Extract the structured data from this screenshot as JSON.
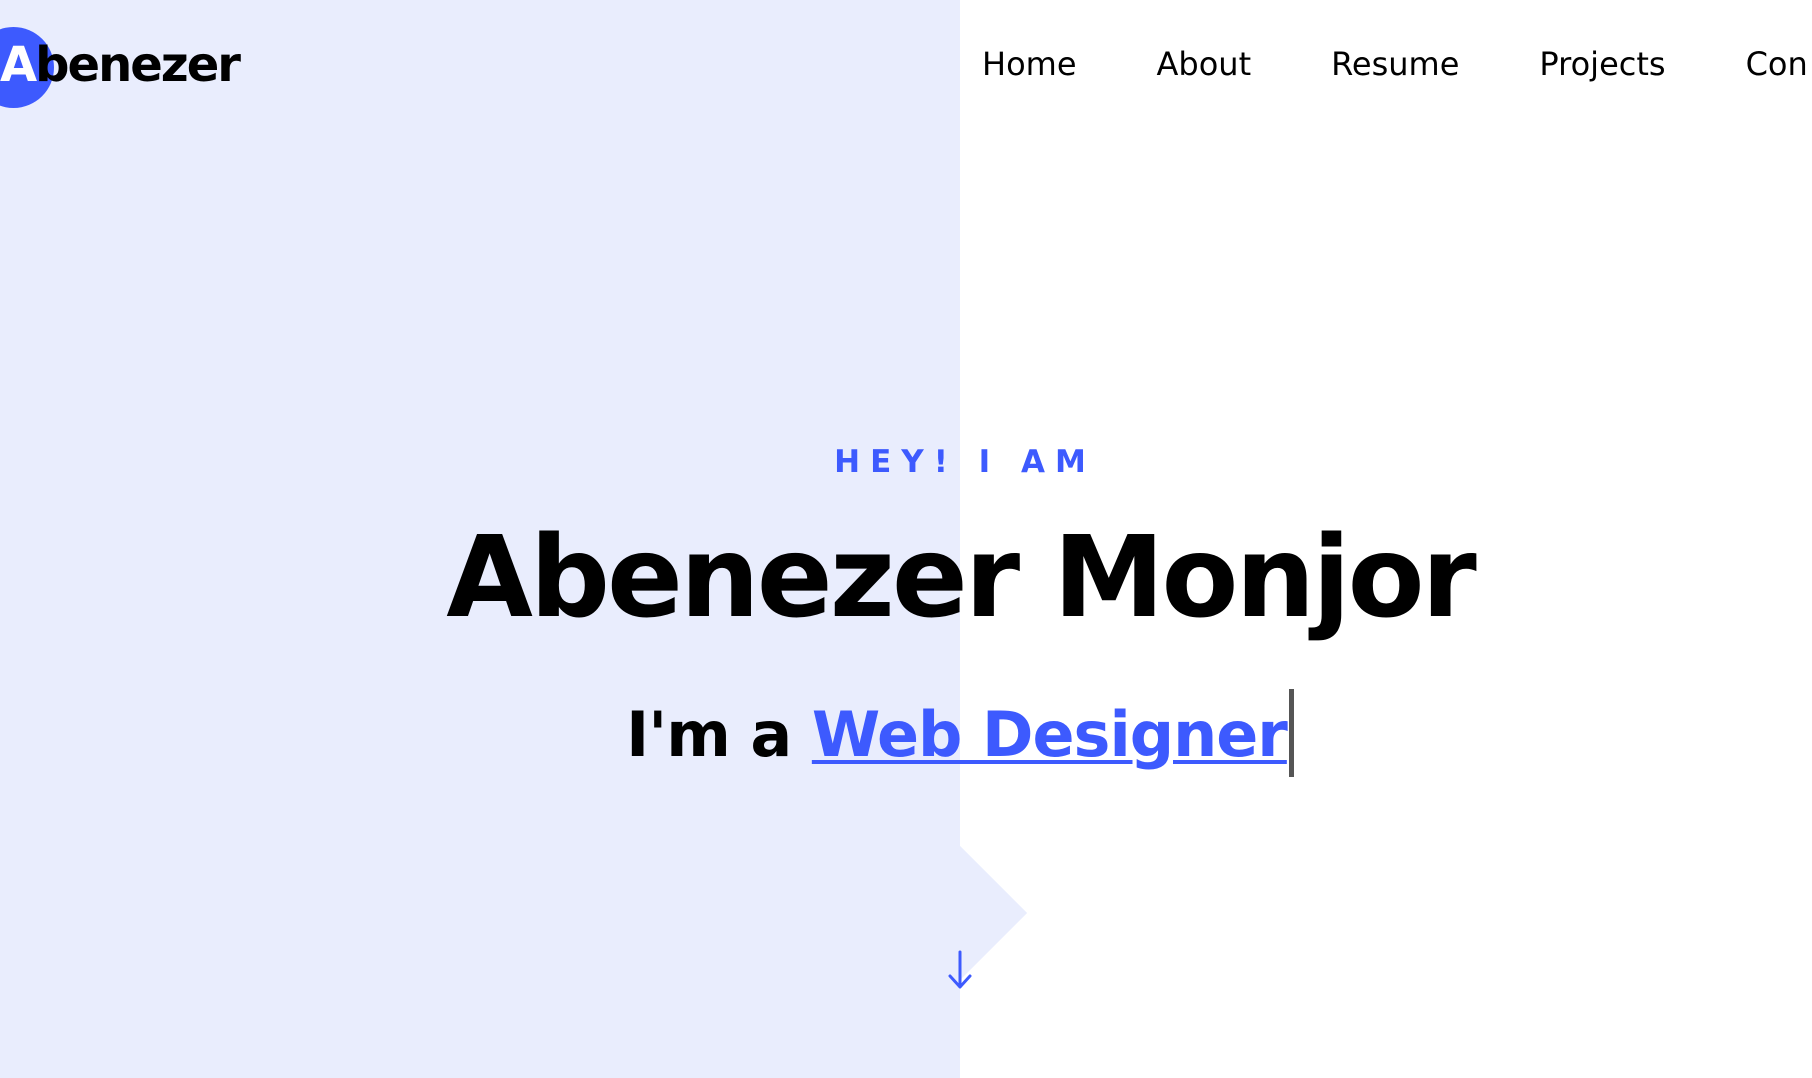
{
  "logo": {
    "first_letter": "A",
    "rest": "benezer"
  },
  "nav": {
    "items": [
      {
        "label": "Home"
      },
      {
        "label": "About"
      },
      {
        "label": "Resume"
      },
      {
        "label": "Projects"
      },
      {
        "label": "Con"
      }
    ]
  },
  "hero": {
    "eyebrow": "HEY! I AM",
    "name": "Abenezer Monjor",
    "tagline_prefix": "I'm a ",
    "role": "Web Designer"
  },
  "icons": {
    "scroll": "arrow-down-icon"
  },
  "colors": {
    "accent": "#3d5afe",
    "panel": "#e9edfd",
    "text": "#000000"
  }
}
